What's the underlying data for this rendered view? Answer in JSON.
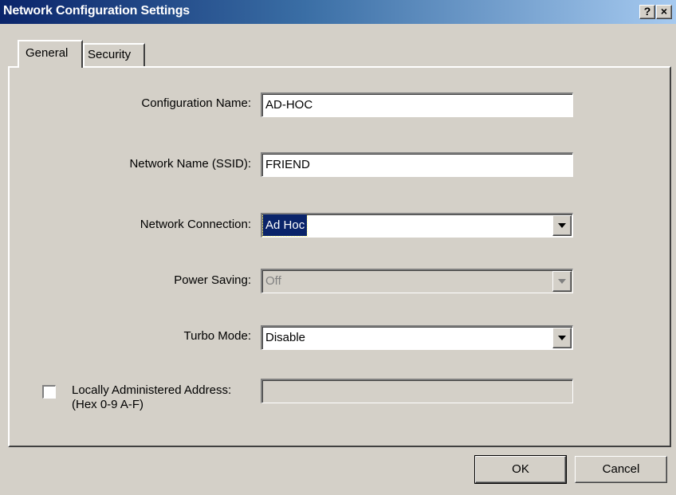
{
  "window": {
    "title": "Network Configuration Settings",
    "help_glyph": "?",
    "close_glyph": "×"
  },
  "tabs": [
    {
      "label": "General",
      "active": true
    },
    {
      "label": "Security",
      "active": false
    }
  ],
  "form": {
    "configuration_name": {
      "label": "Configuration Name:",
      "value": "AD-HOC"
    },
    "network_name": {
      "label": "Network Name (SSID):",
      "value": "FRIEND"
    },
    "network_connection": {
      "label": "Network Connection:",
      "value": "Ad Hoc",
      "selected": true
    },
    "power_saving": {
      "label": "Power Saving:",
      "value": "Off",
      "enabled": false
    },
    "turbo_mode": {
      "label": "Turbo Mode:",
      "value": "Disable"
    },
    "locally_administered": {
      "label_line1": "Locally Administered Address:",
      "label_line2": "(Hex 0-9 A-F)",
      "checked": false,
      "value": ""
    }
  },
  "buttons": {
    "ok_label": "OK",
    "cancel_label": "Cancel"
  },
  "colors": {
    "title_gradient_start": "#0a246a",
    "title_gradient_end": "#a6caf0",
    "dialog_face": "#d4d0c8",
    "selection": "#0a246a"
  }
}
